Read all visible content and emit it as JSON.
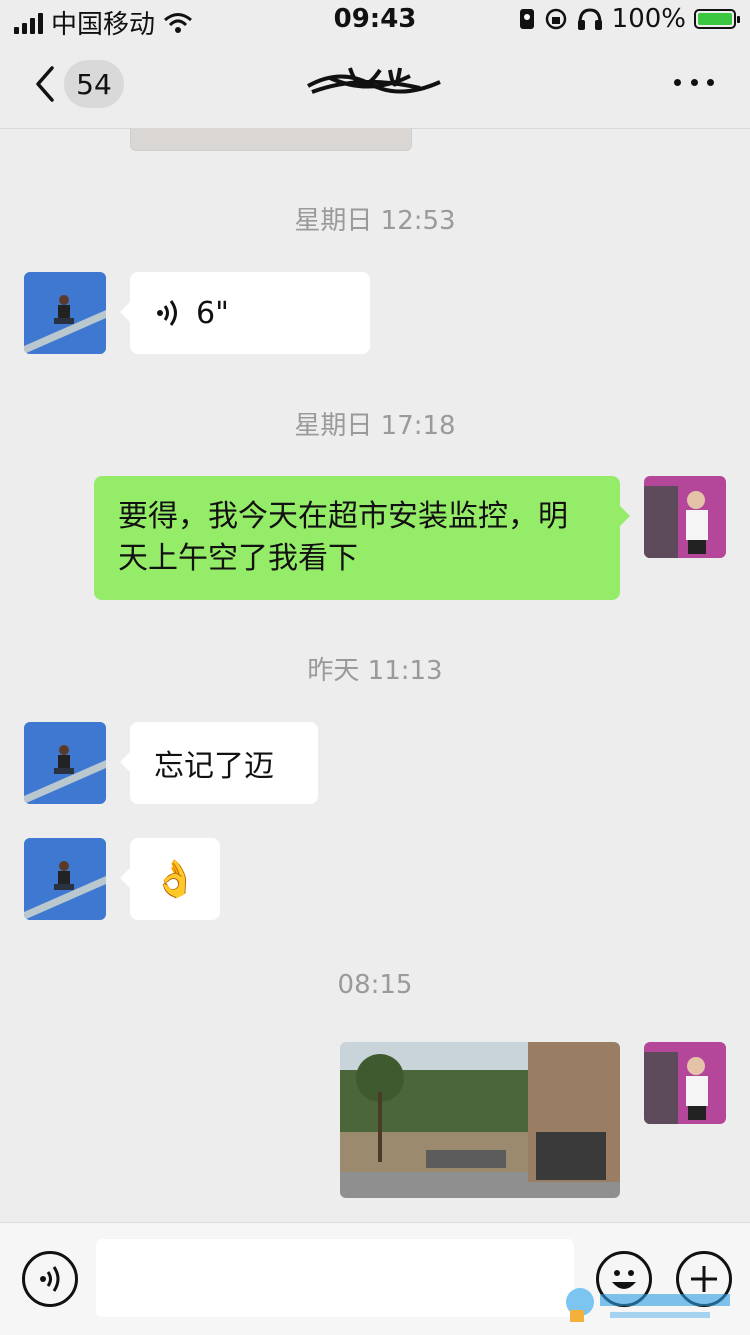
{
  "status_bar": {
    "carrier": "中国移动",
    "time": "09:43",
    "battery": "100%"
  },
  "nav": {
    "unread_count": "54"
  },
  "messages": [
    {
      "timestamp": "星期日 12:53"
    },
    {
      "voice_duration": "6\""
    },
    {
      "timestamp": "星期日 17:18"
    },
    {
      "text": "要得，我今天在超市安装监控，明天上午空了我看下"
    },
    {
      "timestamp": "昨天 11:13"
    },
    {
      "text": "忘记了迈"
    },
    {
      "emoji": "👌"
    },
    {
      "timestamp": "08:15"
    }
  ],
  "colors": {
    "background": "#ededed",
    "sent_bubble": "#95ec69",
    "received_bubble": "#ffffff"
  }
}
